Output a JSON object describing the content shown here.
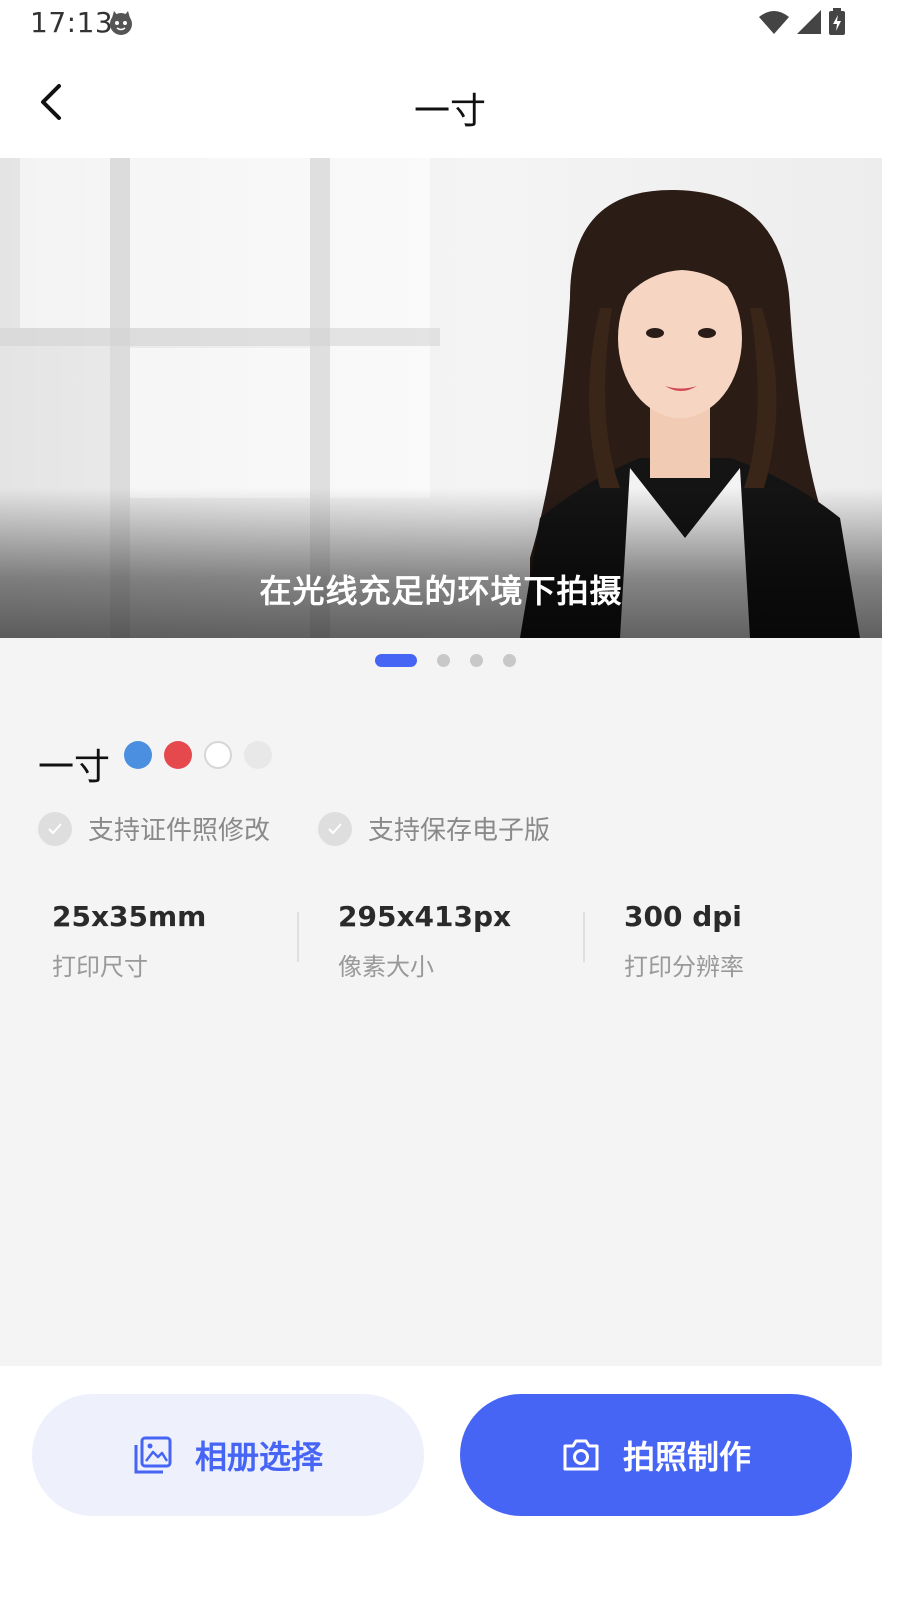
{
  "status_bar": {
    "time": "17:13"
  },
  "header": {
    "title": "一寸"
  },
  "banner": {
    "caption": "在光线充足的环境下拍摄",
    "page_count": 4,
    "active_page": 1
  },
  "spec": {
    "title": "一寸",
    "colors": [
      "#4a8fe0",
      "#e5484d",
      "#ffffff",
      "#e8e8e8"
    ],
    "features": [
      "支持证件照修改",
      "支持保存电子版"
    ],
    "items": [
      {
        "value": "25x35mm",
        "label": "打印尺寸"
      },
      {
        "value": "295x413px",
        "label": "像素大小"
      },
      {
        "value": "300 dpi",
        "label": "打印分辨率"
      }
    ]
  },
  "actions": {
    "album_label": "相册选择",
    "camera_label": "拍照制作"
  },
  "theme": {
    "accent": "#4765f5"
  }
}
